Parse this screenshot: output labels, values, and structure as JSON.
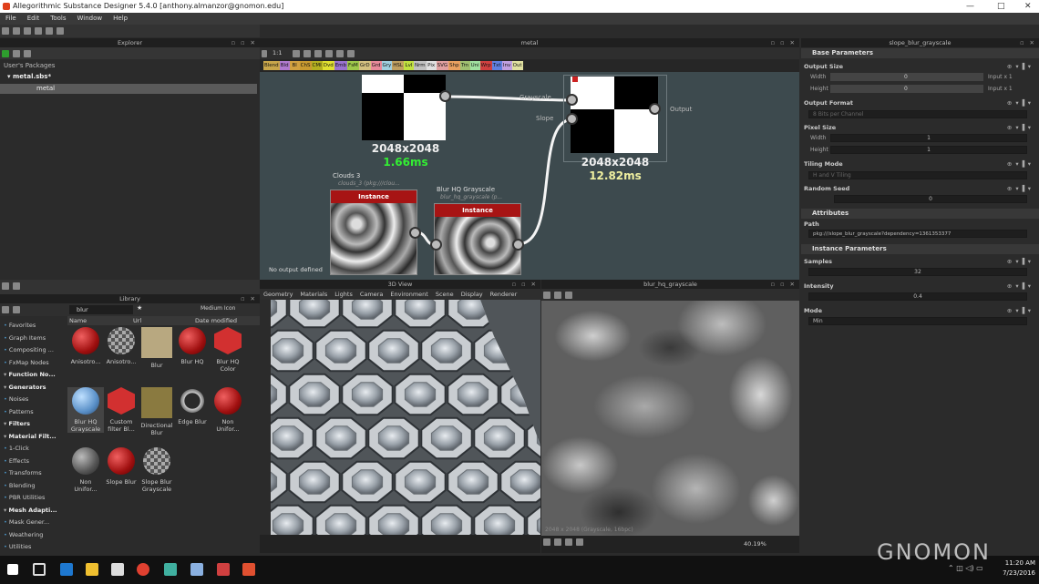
{
  "window_title": "Allegorithmic Substance Designer 5.4.0 [anthony.almanzor@gnomon.edu]",
  "window_controls": [
    "—",
    "□",
    "✕"
  ],
  "menu": [
    "File",
    "Edit",
    "Tools",
    "Window",
    "Help"
  ],
  "explorer": {
    "title": "Explorer",
    "section": "User's Packages",
    "package": "metal.sbs*",
    "graph": "metal"
  },
  "graph": {
    "title": "metal",
    "zoom": "1:1",
    "chips": [
      "Blend",
      "Bld",
      "Bl",
      "ChS",
      "CMI",
      "Dvd",
      "Emb",
      "FsM",
      "GrD",
      "Grd",
      "Gry",
      "HSL",
      "Lvl",
      "Nrm",
      "Pix",
      "SVG",
      "Shp",
      "Trn",
      "Uni",
      "Wrp",
      "Txt",
      "Inv",
      "Out"
    ],
    "chip_colors": [
      "#c8a64a",
      "#b07ad0",
      "#d0a040",
      "#c89a30",
      "#b4b020",
      "#e0e030",
      "#9a72d0",
      "#9ec84a",
      "#d4c080",
      "#e88a9a",
      "#a0d0e0",
      "#c0a060",
      "#c0e040",
      "#c0c0c0",
      "#e0e0e0",
      "#e0a0a0",
      "#e8a060",
      "#a0c070",
      "#a0e0a0",
      "#d04040",
      "#6080e0",
      "#c0a0e0",
      "#e0e0a0"
    ],
    "node_left": {
      "size": "2048x2048",
      "time": "1.66ms"
    },
    "node_right": {
      "size": "2048x2048",
      "time": "12.82ms",
      "port_grayscale": "Grayscale",
      "port_slope": "Slope",
      "port_output": "Output"
    },
    "node_clouds": {
      "title": "Clouds 3",
      "sub": "clouds_3 (pkg:///clou...",
      "badge": "Instance"
    },
    "node_blur": {
      "title": "Blur HQ Grayscale",
      "sub": "blur_hq_grayscale (p...",
      "badge": "Instance"
    },
    "status": "No output defined"
  },
  "properties": {
    "title": "slope_blur_grayscale",
    "sections": {
      "base": "Base Parameters",
      "attributes": "Attributes",
      "instance": "Instance Parameters"
    },
    "output_size": "Output Size",
    "width_label": "Width",
    "height_label": "Height",
    "width_val": "0",
    "height_val": "0",
    "input_x1": "Input x 1",
    "output_format": "Output Format",
    "output_format_val": "8 Bits per Channel",
    "pixel_size": "Pixel Size",
    "ps_width_val": "1",
    "ps_height_val": "1",
    "tiling_mode": "Tiling Mode",
    "tiling_val": "H and V Tiling",
    "random_seed": "Random Seed",
    "seed_val": "0",
    "path_label": "Path",
    "path_val": "pkg:///slope_blur_grayscale?dependency=1361353377",
    "samples": "Samples",
    "samples_val": "32",
    "intensity": "Intensity",
    "intensity_val": "0.4",
    "mode": "Mode",
    "mode_val": "Min",
    "icons": "⊕ ▾ ▌▾"
  },
  "library": {
    "title": "Library",
    "search": "blur",
    "size_mode": "Medium Icon",
    "cols": [
      "Name",
      "Url",
      "Date modified"
    ],
    "categories": [
      {
        "label": "Favorites",
        "bold": false
      },
      {
        "label": "Graph Items",
        "bold": false
      },
      {
        "label": "Compositing ...",
        "bold": false
      },
      {
        "label": "FxMap Nodes",
        "bold": false
      },
      {
        "label": "Function No...",
        "bold": true
      },
      {
        "label": "Generators",
        "bold": true
      },
      {
        "label": "Noises",
        "bold": false
      },
      {
        "label": "Patterns",
        "bold": false
      },
      {
        "label": "Filters",
        "bold": true
      },
      {
        "label": "Material Filt...",
        "bold": true
      },
      {
        "label": "1-Click",
        "bold": false
      },
      {
        "label": "Effects",
        "bold": false
      },
      {
        "label": "Transforms",
        "bold": false
      },
      {
        "label": "Blending",
        "bold": false
      },
      {
        "label": "PBR Utilities",
        "bold": false
      },
      {
        "label": "Mesh Adapti...",
        "bold": true
      },
      {
        "label": "Mask Gener...",
        "bold": false
      },
      {
        "label": "Weathering",
        "bold": false
      },
      {
        "label": "Utilities",
        "bold": false
      }
    ],
    "items": [
      {
        "label": "Anisotro...",
        "kind": "red"
      },
      {
        "label": "Anisotro...",
        "kind": "checker"
      },
      {
        "label": "Blur",
        "kind": "tan"
      },
      {
        "label": "Blur HQ",
        "kind": "red"
      },
      {
        "label": "Blur HQ Color",
        "kind": "logo"
      },
      {
        "label": "Blur HQ Grayscale",
        "kind": "blue"
      },
      {
        "label": "Custom filter Bl...",
        "kind": "logo"
      },
      {
        "label": "Directional Blur",
        "kind": "olive"
      },
      {
        "label": "Edge Blur",
        "kind": "ring"
      },
      {
        "label": "Non Unifor...",
        "kind": "red"
      },
      {
        "label": "Non Unifor...",
        "kind": "gray"
      },
      {
        "label": "Slope Blur",
        "kind": "red"
      },
      {
        "label": "Slope Blur Grayscale",
        "kind": "checker"
      }
    ]
  },
  "view3d": {
    "title": "3D View",
    "tabs": [
      "Geometry",
      "Materials",
      "Lights",
      "Camera",
      "Environment",
      "Scene",
      "Display",
      "Renderer"
    ]
  },
  "view2d": {
    "title": "blur_hq_grayscale",
    "info": "2048 x 2048 (Grayscale, 16bpc)",
    "zoom": "40.19%"
  },
  "taskbar": {
    "time": "11:20 AM",
    "date": "7/23/2016"
  },
  "watermark": "GNOMON"
}
